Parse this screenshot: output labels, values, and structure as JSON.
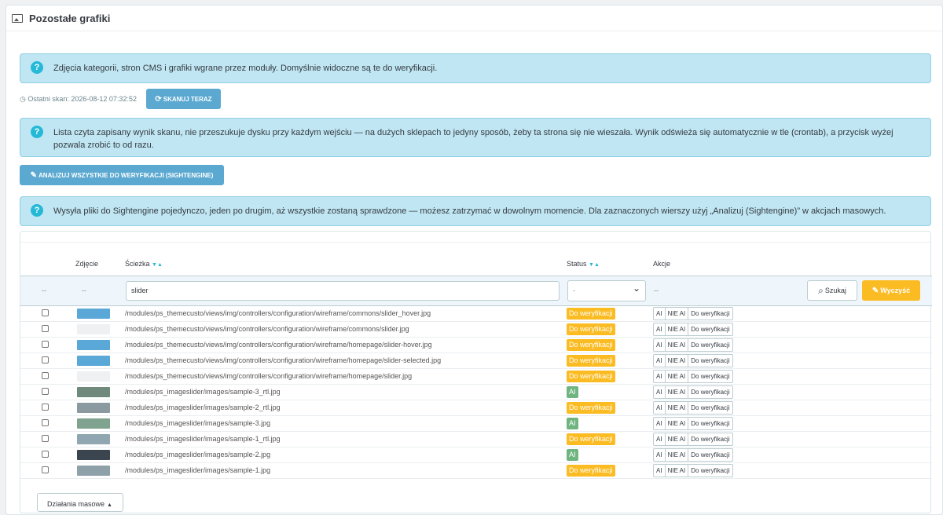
{
  "panel": {
    "title": "Pozostałe grafiki"
  },
  "alerts": [
    "Zdjęcia kategorii, stron CMS i grafiki wgrane przez moduły. Domyślnie widoczne są te do weryfikacji.",
    "Lista czyta zapisany wynik skanu, nie przeszukuje dysku przy każdym wejściu — na dużych sklepach to jedyny sposób, żeby ta strona się nie wieszała. Wynik odświeża się automatycznie w tle (crontab), a przycisk wyżej pozwala zrobić to od razu.",
    "Wysyła pliki do Sightengine pojedynczo, jeden po drugim, aż wszystkie zostaną sprawdzone — możesz zatrzymać w dowolnym momencie. Dla zaznaczonych wierszy użyj „Analizuj (Sightengine)” w akcjach masowych."
  ],
  "scan": {
    "last": "Ostatni skan: 2026-08-12 07:32:52",
    "button": "SKANUJ TERAZ"
  },
  "analyze_button": "ANALIZUJ WSZYSTKIE DO WERYFIKACJI (SIGHTENGINE)",
  "table": {
    "headers": {
      "image": "Zdjęcie",
      "path": "Ścieżka",
      "status": "Status",
      "actions": "Akcje"
    },
    "filters": {
      "dash": "--",
      "path_value": "slider",
      "status_value": "-",
      "search": "Szukaj",
      "clear": "Wyczyść"
    },
    "action_labels": [
      "AI",
      "NIE AI",
      "Do weryfikacji"
    ],
    "rows": [
      {
        "path": "/modules/ps_themecusto/views/img/controllers/configuration/wireframe/commons/slider_hover.jpg",
        "status": "Do weryfikacji",
        "kind": "warn",
        "thumb": "#5aa8d8"
      },
      {
        "path": "/modules/ps_themecusto/views/img/controllers/configuration/wireframe/commons/slider.jpg",
        "status": "Do weryfikacji",
        "kind": "warn",
        "thumb": "#eef0f2"
      },
      {
        "path": "/modules/ps_themecusto/views/img/controllers/configuration/wireframe/homepage/slider-hover.jpg",
        "status": "Do weryfikacji",
        "kind": "warn",
        "thumb": "#5aa8d8"
      },
      {
        "path": "/modules/ps_themecusto/views/img/controllers/configuration/wireframe/homepage/slider-selected.jpg",
        "status": "Do weryfikacji",
        "kind": "warn",
        "thumb": "#5aa8d8"
      },
      {
        "path": "/modules/ps_themecusto/views/img/controllers/configuration/wireframe/homepage/slider.jpg",
        "status": "Do weryfikacji",
        "kind": "warn",
        "thumb": "#eef0f2"
      },
      {
        "path": "/modules/ps_imageslider/images/sample-3_rtl.jpg",
        "status": "AI",
        "kind": "ai",
        "thumb": "#6f8a7c"
      },
      {
        "path": "/modules/ps_imageslider/images/sample-2_rtl.jpg",
        "status": "Do weryfikacji",
        "kind": "warn",
        "thumb": "#8a9aa0"
      },
      {
        "path": "/modules/ps_imageslider/images/sample-3.jpg",
        "status": "AI",
        "kind": "ai",
        "thumb": "#7fa38f"
      },
      {
        "path": "/modules/ps_imageslider/images/sample-1_rtl.jpg",
        "status": "Do weryfikacji",
        "kind": "warn",
        "thumb": "#90a6b0"
      },
      {
        "path": "/modules/ps_imageslider/images/sample-2.jpg",
        "status": "AI",
        "kind": "ai",
        "thumb": "#3a4550"
      },
      {
        "path": "/modules/ps_imageslider/images/sample-1.jpg",
        "status": "Do weryfikacji",
        "kind": "warn",
        "thumb": "#8ea0a8"
      }
    ]
  },
  "bulk_button": "Działania masowe"
}
